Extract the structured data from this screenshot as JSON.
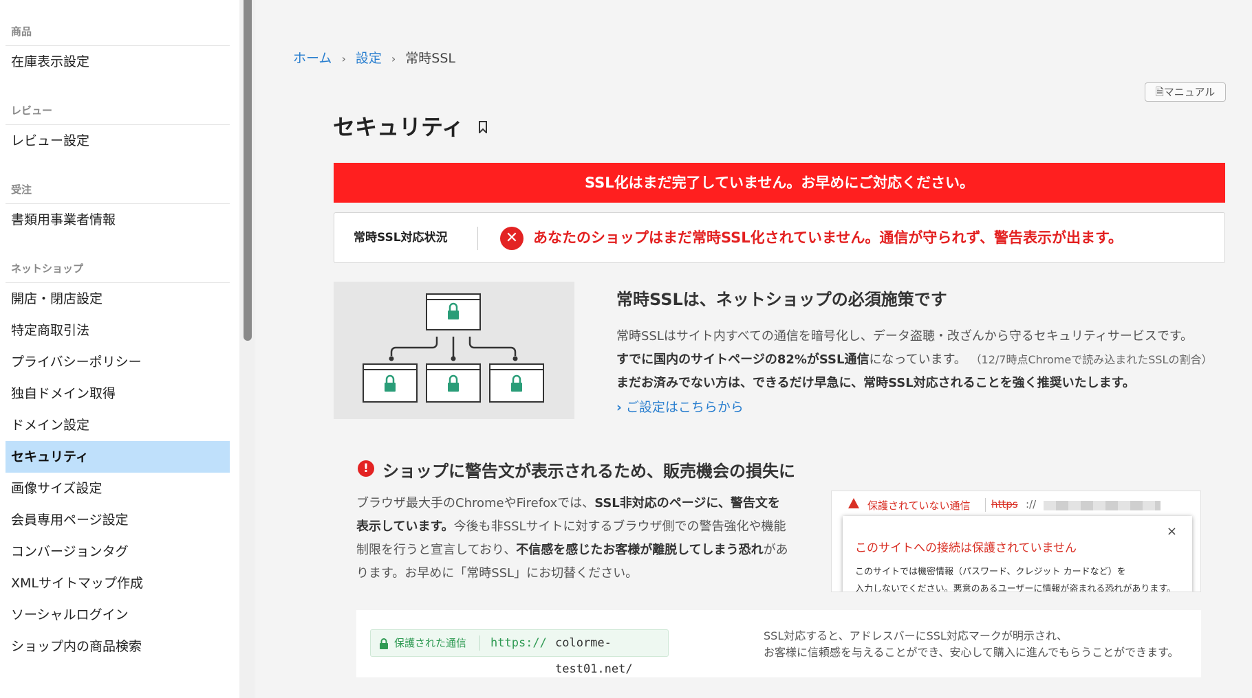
{
  "sidebar": {
    "sections": [
      {
        "title": "商品",
        "items": [
          {
            "label": "在庫表示設定"
          }
        ]
      },
      {
        "title": "レビュー",
        "items": [
          {
            "label": "レビュー設定"
          }
        ]
      },
      {
        "title": "受注",
        "items": [
          {
            "label": "書類用事業者情報"
          }
        ]
      },
      {
        "title": "ネットショップ",
        "items": [
          {
            "label": "開店・閉店設定"
          },
          {
            "label": "特定商取引法"
          },
          {
            "label": "プライバシーポリシー"
          },
          {
            "label": "独自ドメイン取得"
          },
          {
            "label": "ドメイン設定"
          },
          {
            "label": "セキュリティ",
            "active": true
          },
          {
            "label": "画像サイズ設定"
          },
          {
            "label": "会員専用ページ設定"
          },
          {
            "label": "コンバージョンタグ"
          },
          {
            "label": "XMLサイトマップ作成"
          },
          {
            "label": "ソーシャルログイン"
          },
          {
            "label": "ショップ内の商品検索"
          }
        ]
      }
    ]
  },
  "breadcrumb": {
    "home": "ホーム",
    "settings": "設定",
    "current": "常時SSL",
    "sep": "›"
  },
  "manual_button": "マニュアル",
  "page_title": "セキュリティ",
  "alert_bar": "SSL化はまだ完了していません。お早めにご対応ください。",
  "status": {
    "label": "常時SSL対応状況",
    "message": "あなたのショップはまだ常時SSL化されていません。通信が守られず、警告表示が出ます。"
  },
  "intro": {
    "title": "常時SSLは、ネットショップの必須施策です",
    "line1": "常時SSLはサイト内すべての通信を暗号化し、データ盗聴・改ざんから守るセキュリティサービスです。",
    "line2_bold": "すでに国内のサイトページの82%がSSL通信",
    "line2_rest": "になっています。",
    "line2_note": "（12/7時点Chromeで読み込まれたSSLの割合）",
    "line3": "まだお済みでない方は、できるだけ早急に、常時SSL対応されることを強く推奨いたします。",
    "link": "ご設定はこちらから"
  },
  "warning": {
    "title": "ショップに警告文が表示されるため、販売機会の損失に",
    "l1_a": "ブラウザ最大手のChromeやFirefoxでは、",
    "l1_b": "SSL非対応のページに、警告文を",
    "l2_b": "表示しています。",
    "l2_a": "今後も非SSLサイトに対するブラウザ側での警告強化や機能",
    "l3_a": "制限を行うと宣言しており、",
    "l3_b": "不信感を感じたお客様が離脱してしまう恐れ",
    "l3_c": "があ",
    "l4": "ります。お早めに「常時SSL」にお切替ください。"
  },
  "browser_mock": {
    "warn_text": "保護されていない通信",
    "https": "https",
    "https_tail": "://",
    "close": "×",
    "popup_title": "このサイトへの接続は保護されていません",
    "popup_l1": "このサイトでは機密情報（パスワード、クレジット カードなど）を",
    "popup_l2": "入力しないでください。悪意のあるユーザーに情報が盗まれる恐れがあります。"
  },
  "secure": {
    "label": "保護された通信",
    "url_prefix": "https://",
    "url": "colorme-test01.net/",
    "desc1": "SSL対応すると、アドレスバーにSSL対応マークが明示され、",
    "desc2": "お客様に信頼感を与えることができ、安心して購入に進んでもらうことができます。"
  },
  "colors": {
    "accent": "#2a7fcf",
    "alert": "#ff1f1f",
    "error": "#e32020",
    "secure": "#2f9a53",
    "diagram_lock": "#2a9d78"
  }
}
